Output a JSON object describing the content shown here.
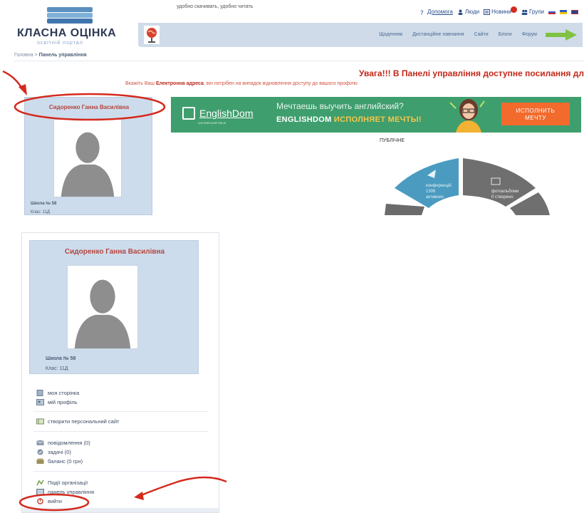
{
  "top_screenshot": {
    "site": {
      "title": "КЛАСНА ОЦІНКА",
      "subtitle": "освітній портал",
      "slogan": "удобно скачивать, удобно читать"
    },
    "top_links": [
      "Допомога",
      "Люди",
      "Новини",
      "Групи"
    ],
    "nav_links": [
      "Щоденник",
      "Дистанційне навчання",
      "Сайти",
      "Блоги",
      "Форум"
    ],
    "breadcrumb": {
      "home": "Головна",
      "separator": " > ",
      "current": "Панель управління"
    },
    "warning": {
      "title": "Увага!!! В Панелі управління доступне посилання дл",
      "sub_before": "Вкажіть Ваш ",
      "sub_bold": "Електронна адреса",
      "sub_after": ", він потрібен на випадок відновлення доступу до вашого профілю"
    },
    "profile": {
      "name": "Сидоренко Ганна Василівна",
      "school": "Школа № 58",
      "class": "Клас: 11Д"
    },
    "banner": {
      "brand": "EnglishDom",
      "brand_tag": "АНГЛИЙСКИЙ ЯЗЫК",
      "line1": "Мечтаешь выучить английский?",
      "line2_white": "ENGLISHDOM ",
      "line2_yellow": "ИСПОЛНЯЕТ МЕЧТЫ!",
      "button_line1": "ИСПОЛНИТЬ",
      "button_line2": "МЕЧТУ"
    },
    "public_label": "ПУБЛІЧНЕ",
    "wheel": {
      "seg1_line1": "конференцій",
      "seg1_line2": "1306",
      "seg1_line3": "активних",
      "seg2_line1": "фотоальбоми",
      "seg2_line2": "0 створено"
    }
  },
  "bottom_screenshot": {
    "profile": {
      "name": "Сидоренко Ганна Василівна",
      "school": "Школа № 58",
      "class": "Клас: 11Д"
    },
    "menu": {
      "my_page": "моя сторінка",
      "my_profile": "мій профіль",
      "create_site": "створити персональний сайт",
      "messages": "повідомлення (0)",
      "tasks": "задачі (0)",
      "balance": "баланс (0 грн)",
      "org_events": "Події організації",
      "control_panel": "панель управління",
      "logout": "вийти"
    }
  },
  "colors": {
    "highlight_red": "#d42a1e",
    "panel_blue": "#cddcec",
    "banner_green": "#3f9e6e",
    "banner_orange": "#f26b2d"
  },
  "icons": [
    "help-icon",
    "people-icon",
    "news-icon",
    "groups-icon",
    "globe-icon",
    "arrow-icon",
    "page-icon",
    "profile-icon",
    "site-icon",
    "mail-icon",
    "tasks-icon",
    "balance-icon",
    "events-icon",
    "panel-icon",
    "logout-icon"
  ]
}
